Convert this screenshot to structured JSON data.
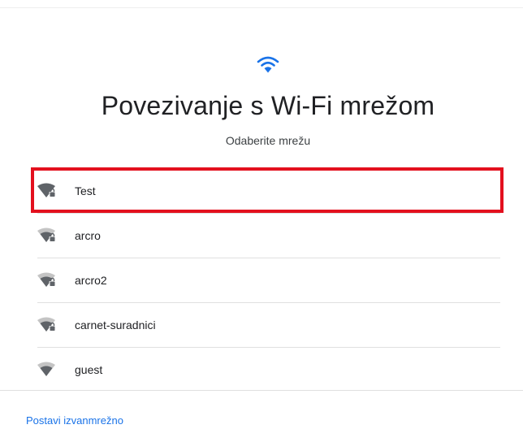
{
  "header": {
    "icon": "wifi-icon",
    "title": "Povezivanje s Wi-Fi mrežom",
    "subtitle": "Odaberite mrežu"
  },
  "networks": [
    {
      "ssid": "Test",
      "secured": true,
      "icon": "wifi-lock-icon",
      "highlighted": true
    },
    {
      "ssid": "arcro",
      "secured": true,
      "icon": "wifi-lock-icon",
      "highlighted": false
    },
    {
      "ssid": "arcro2",
      "secured": true,
      "icon": "wifi-lock-icon",
      "highlighted": false
    },
    {
      "ssid": "carnet-suradnici",
      "secured": true,
      "icon": "wifi-lock-icon",
      "highlighted": false
    },
    {
      "ssid": "guest",
      "secured": false,
      "icon": "wifi-icon",
      "highlighted": false
    }
  ],
  "footer": {
    "offline_link": "Postavi izvanmrežno"
  },
  "colors": {
    "accent": "#1a73e8",
    "highlight": "#e3101e",
    "icon": "#5f6368"
  }
}
